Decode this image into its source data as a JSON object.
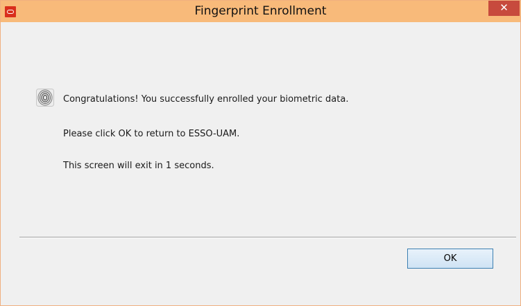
{
  "window": {
    "title": "Fingerprint Enrollment",
    "close_glyph": "✕"
  },
  "content": {
    "icon": "fingerprint-icon",
    "messages": [
      "Congratulations! You successfully enrolled your biometric data.",
      "Please click OK to return to ESSO-UAM.",
      "This screen will exit in 1 seconds."
    ]
  },
  "buttons": {
    "ok_label": "OK"
  },
  "colors": {
    "titlebar": "#f8ba7a",
    "close_button": "#c74a3d",
    "app_icon": "#d92e1c",
    "body": "#f0f0f0"
  }
}
